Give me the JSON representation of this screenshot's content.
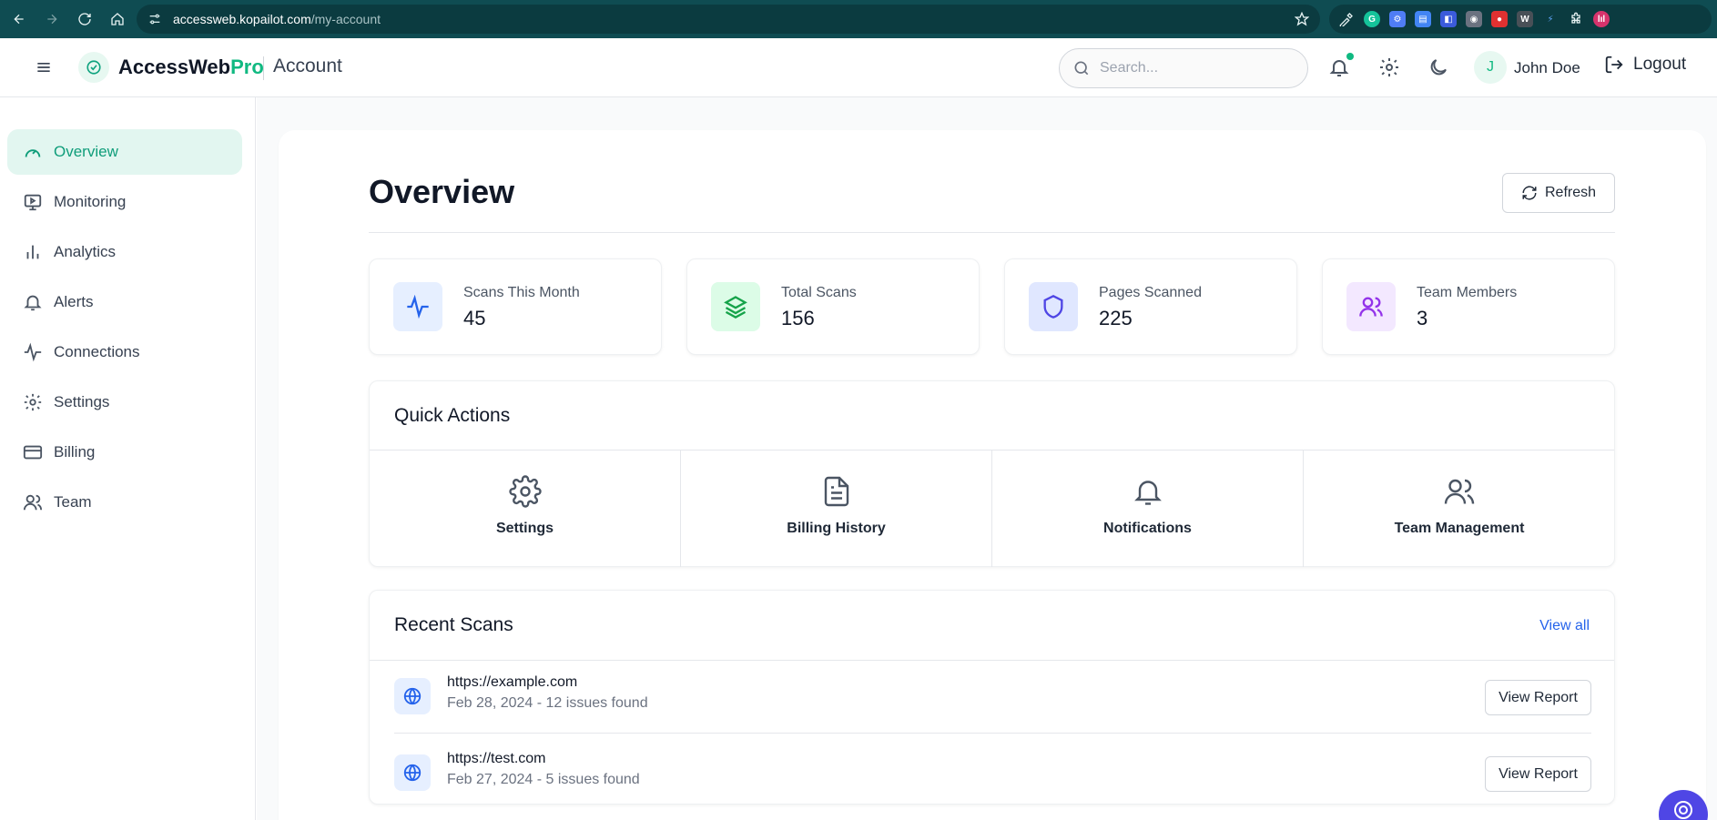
{
  "browser": {
    "url_host": "accessweb.kopailot.com",
    "url_path": "/my-account"
  },
  "header": {
    "brand_main": "AccessWeb",
    "brand_accent": "Pro",
    "section": "Account",
    "search_placeholder": "Search...",
    "avatar_initial": "J",
    "user_name": "John Doe",
    "logout_label": "Logout"
  },
  "sidebar": {
    "items": [
      {
        "label": "Overview",
        "icon": "gauge-icon",
        "active": true
      },
      {
        "label": "Monitoring",
        "icon": "monitor-icon"
      },
      {
        "label": "Analytics",
        "icon": "bar-chart-icon"
      },
      {
        "label": "Alerts",
        "icon": "bell-icon"
      },
      {
        "label": "Connections",
        "icon": "activity-icon"
      },
      {
        "label": "Settings",
        "icon": "gear-icon"
      },
      {
        "label": "Billing",
        "icon": "credit-card-icon"
      },
      {
        "label": "Team",
        "icon": "users-icon"
      }
    ]
  },
  "main": {
    "title": "Overview",
    "refresh_label": "Refresh",
    "stats": [
      {
        "label": "Scans This Month",
        "value": "45",
        "icon": "activity-icon",
        "bg": "#e6efff",
        "fg": "#2563eb"
      },
      {
        "label": "Total Scans",
        "value": "156",
        "icon": "layers-icon",
        "bg": "#dcfce7",
        "fg": "#16a34a"
      },
      {
        "label": "Pages Scanned",
        "value": "225",
        "icon": "shield-icon",
        "bg": "#e0e7ff",
        "fg": "#4f46e5"
      },
      {
        "label": "Team Members",
        "value": "3",
        "icon": "users-icon",
        "bg": "#f3e8ff",
        "fg": "#9333ea"
      }
    ],
    "quick_actions": {
      "title": "Quick Actions",
      "items": [
        {
          "label": "Settings",
          "icon": "gear-icon"
        },
        {
          "label": "Billing History",
          "icon": "document-icon"
        },
        {
          "label": "Notifications",
          "icon": "bell-icon"
        },
        {
          "label": "Team Management",
          "icon": "users-icon"
        }
      ]
    },
    "recent_scans": {
      "title": "Recent Scans",
      "view_all": "View all",
      "rows": [
        {
          "url": "https://example.com",
          "meta": "Feb 28, 2024 - 12 issues found",
          "button": "View Report"
        },
        {
          "url": "https://test.com",
          "meta": "Feb 27, 2024 - 5 issues found",
          "button": "View Report"
        }
      ]
    }
  }
}
